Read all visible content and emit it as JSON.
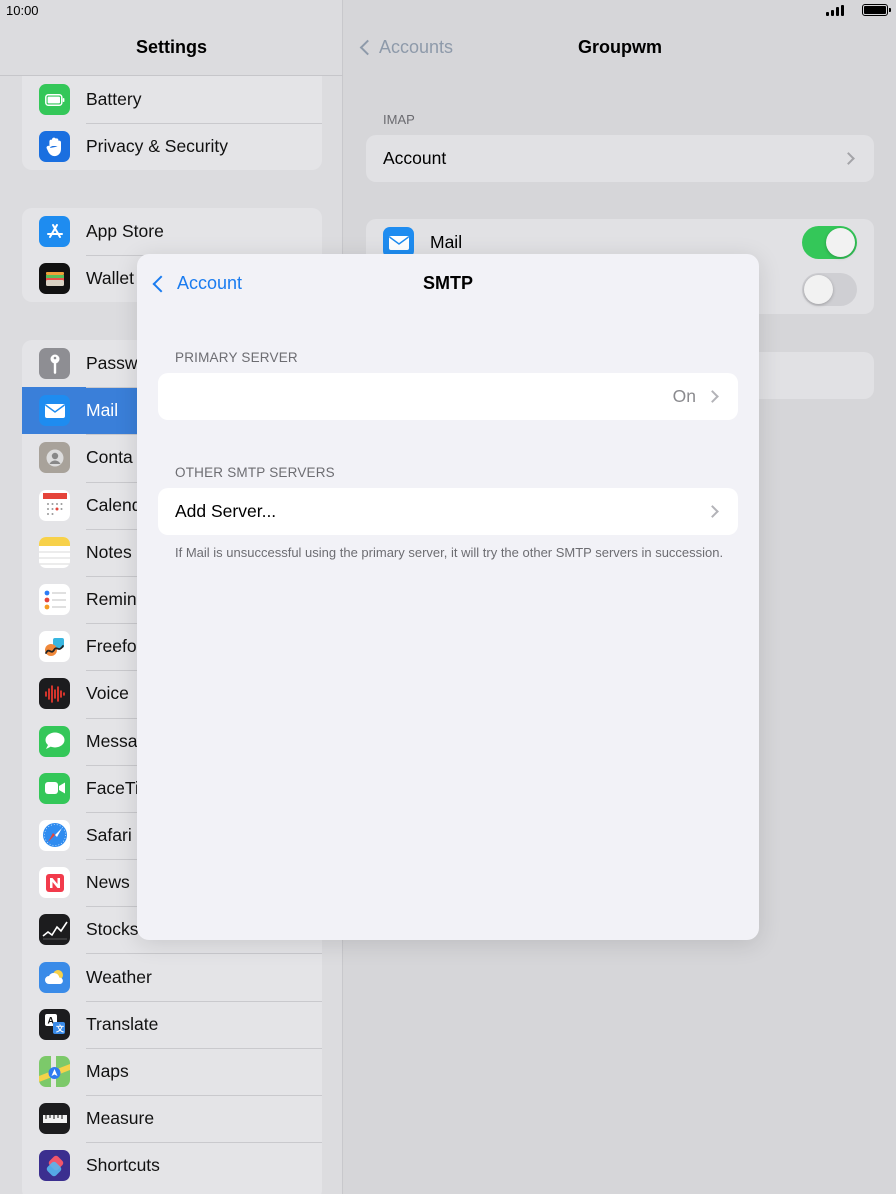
{
  "status_bar": {
    "time": "10:00"
  },
  "sidebar": {
    "title": "Settings",
    "groups": [
      {
        "items": [
          {
            "label": "Battery",
            "icon": "battery-icon",
            "color": "#34c759"
          },
          {
            "label": "Privacy & Security",
            "icon": "hand-icon",
            "color": "#1a6fe0"
          }
        ]
      },
      {
        "items": [
          {
            "label": "App Store",
            "icon": "app-store-icon",
            "color": "#1e8cf0"
          },
          {
            "label": "Wallet",
            "icon": "wallet-icon",
            "color": "#111111"
          }
        ]
      },
      {
        "items": [
          {
            "label": "Passw",
            "icon": "key-icon",
            "color": "#8e8e93"
          },
          {
            "label": "Mail",
            "icon": "mail-icon",
            "color": "#1e8cf0",
            "selected": true
          },
          {
            "label": "Conta",
            "icon": "contacts-icon",
            "color": "#a8a29a"
          },
          {
            "label": "Calend",
            "icon": "calendar-icon",
            "color": "#ffffff"
          },
          {
            "label": "Notes",
            "icon": "notes-icon",
            "color": "#f7d14a"
          },
          {
            "label": "Remin",
            "icon": "reminders-icon",
            "color": "#ffffff"
          },
          {
            "label": "Freefo",
            "icon": "freeform-icon",
            "color": "#ffffff"
          },
          {
            "label": "Voice",
            "icon": "voice-memos-icon",
            "color": "#1c1c1e"
          },
          {
            "label": "Messa",
            "icon": "messages-icon",
            "color": "#34c759"
          },
          {
            "label": "FaceTi",
            "icon": "facetime-icon",
            "color": "#34c759"
          },
          {
            "label": "Safari",
            "icon": "safari-icon",
            "color": "#ffffff"
          },
          {
            "label": "News",
            "icon": "news-icon",
            "color": "#ffffff"
          },
          {
            "label": "Stocks",
            "icon": "stocks-icon",
            "color": "#1c1c1e"
          },
          {
            "label": "Weather",
            "icon": "weather-icon",
            "color": "#3a8be8"
          },
          {
            "label": "Translate",
            "icon": "translate-icon",
            "color": "#1c1c1e"
          },
          {
            "label": "Maps",
            "icon": "maps-icon",
            "color": "#7cc96a"
          },
          {
            "label": "Measure",
            "icon": "measure-icon",
            "color": "#1c1c1e"
          },
          {
            "label": "Shortcuts",
            "icon": "shortcuts-icon",
            "color": "#5b4fd6"
          }
        ]
      }
    ]
  },
  "detail": {
    "back_label": "Accounts",
    "title": "Groupwm",
    "section_label": "IMAP",
    "account_label": "Account",
    "mail_label": "Mail",
    "mail_toggle_on": true,
    "second_toggle_on": false
  },
  "sheet": {
    "back_label": "Account",
    "title": "SMTP",
    "primary_section": "PRIMARY SERVER",
    "primary_value": "On",
    "other_section": "OTHER SMTP SERVERS",
    "add_server_label": "Add Server...",
    "footer": "If Mail is unsuccessful using the primary server, it will try the other SMTP servers in succession."
  },
  "colors": {
    "accent": "#1a7cf0",
    "toggle_on": "#34c759",
    "toggle_off": "#d1d1d6"
  }
}
